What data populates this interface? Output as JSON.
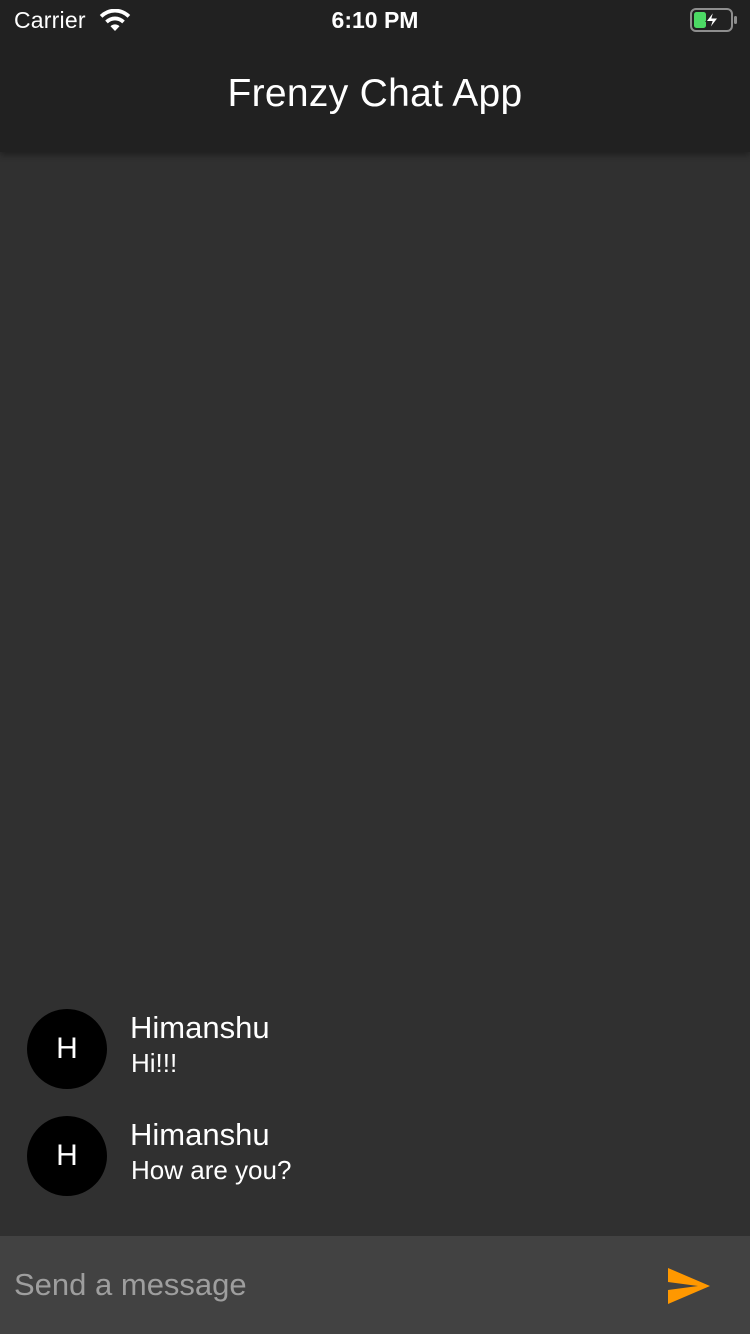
{
  "status_bar": {
    "carrier": "Carrier",
    "time": "6:10 PM",
    "wifi_icon": "wifi-icon",
    "battery_icon": "battery-charging-icon"
  },
  "header": {
    "title": "Frenzy Chat App",
    "background": "#212121"
  },
  "messages": [
    {
      "avatar_initial": "H",
      "sender": "Himanshu",
      "text": "Hi!!!"
    },
    {
      "avatar_initial": "H",
      "sender": "Himanshu",
      "text": "How are you?"
    }
  ],
  "composer": {
    "placeholder": "Send a message",
    "value": "",
    "send_icon": "send-icon"
  },
  "colors": {
    "background": "#303030",
    "composer": "#424242",
    "accent": "#FF9800",
    "avatar": "#000000"
  }
}
